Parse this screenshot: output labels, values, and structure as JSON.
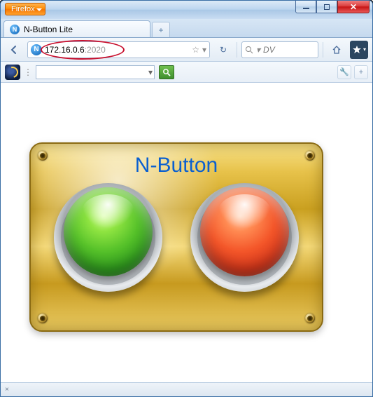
{
  "browser": {
    "menu_label": "Firefox"
  },
  "tabs": {
    "items": [
      {
        "title": "N-Button Lite",
        "favicon_letter": "N"
      }
    ],
    "newtab_symbol": "+"
  },
  "nav": {
    "url_host": "172.16.0.6",
    "url_port": ":2020",
    "favicon_letter": "N",
    "search_placeholder": "DV",
    "star_symbol": "☆",
    "dropdown_symbol": "▾",
    "reload_symbol": "↻"
  },
  "toolbar2": {
    "combo_value": "",
    "dropdown_symbol": "▾",
    "wrench_symbol": "🔧",
    "plus_symbol": "+"
  },
  "content": {
    "panel_title": "N-Button",
    "buttons": {
      "green": {
        "color": "#3fae2a"
      },
      "red": {
        "color": "#e8502e"
      }
    }
  },
  "status": {
    "close_symbol": "×"
  },
  "colors": {
    "accent_blue": "#0a5fd0",
    "highlight_ring": "#c8102e"
  }
}
